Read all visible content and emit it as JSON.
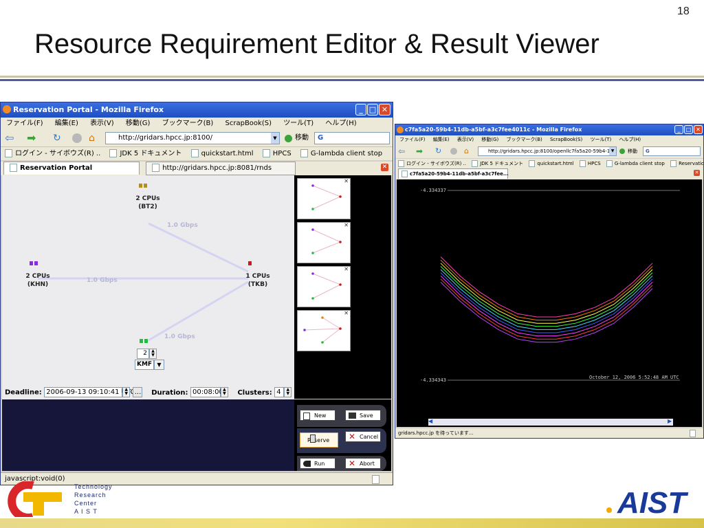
{
  "slide": {
    "number": "18",
    "title": "Resource Requirement Editor & Result Viewer",
    "logo_text": [
      "Technology",
      "Research",
      "Center",
      "A I S T"
    ],
    "aist_logo_text": "AIST"
  },
  "colors": {
    "titlebar": "#1e4fc2",
    "node_purple": "#8a2be2",
    "node_red": "#cc1a1a",
    "node_green": "#22bb44",
    "node_gold": "#b58f1a"
  },
  "left_window": {
    "title": "Reservation Portal - Mozilla Firefox",
    "menu": [
      "ファイル(F)",
      "編集(E)",
      "表示(V)",
      "移動(G)",
      "ブックマーク(B)",
      "ScrapBook(S)",
      "ツール(T)",
      "ヘルプ(H)"
    ],
    "url": "http://gridars.hpcc.jp:8100/",
    "go_label": "移動",
    "search_icon": "G",
    "bookmarks": [
      "ログイン - サイボウズ(R) ..",
      "JDK 5 ドキュメント",
      "quickstart.html",
      "HPCS",
      "G-lambda client stop"
    ],
    "tabs": [
      {
        "label": "Reservation Portal",
        "active": true
      },
      {
        "label": "http://gridars.hpcc.jp:8081/rnds",
        "active": false
      }
    ],
    "nodes": [
      {
        "cpus": "2 CPUs",
        "site": "(BT2)"
      },
      {
        "cpus": "2 CPUs",
        "site": "(KHN)"
      },
      {
        "cpus": "1 CPUs",
        "site": "(TKB)"
      }
    ],
    "links": [
      "1.0 Gbps",
      "1.0 Gbps",
      "1.0 Gbps"
    ],
    "spinner_value": "2",
    "select_value": "KMF",
    "params": {
      "deadline_label": "Deadline:",
      "deadline_value": "2006-09-13 09:10:41 UTC",
      "deadline_button": "...",
      "duration_label": "Duration:",
      "duration_value": "00:08:00",
      "clusters_label": "Clusters:",
      "clusters_value": "4"
    },
    "buttons": {
      "new": "New",
      "save": "Save",
      "reserve": "Reserve",
      "cancel": "Cancel",
      "run": "Run",
      "abort": "Abort"
    },
    "status": "javascript:void(0)"
  },
  "right_window": {
    "title": "c7fa5a20-59b4-11db-a5bf-a3c7fee4011c - Mozilla Firefox",
    "menu": [
      "ファイル(F)",
      "編集(E)",
      "表示(V)",
      "移動(G)",
      "ブックマーク(B)",
      "ScrapBook(S)",
      "ツール(T)",
      "ヘルプ(H)"
    ],
    "url": "http://gridars.hpcc.jp:8100/openllc7fa5a20-59b4-11db-a",
    "go_label": "移動",
    "search_icon": "G",
    "bookmarks": [
      "ログイン - サイボウズ(R) ..",
      "JDK 5 ドキュメント",
      "quickstart.html",
      "HPCS",
      "G-lambda client stop",
      "Reservation Portal"
    ],
    "tab": "c7fa5a20-59b4-11db-a5bf-a3c7fee...",
    "plot": {
      "top_value": "-4.334337",
      "bottom_value": "-4.334343",
      "timestamp": "October 12, 2006 5:52:48 AM UTC"
    },
    "status": "gridars.hpcc.jp を待っています..."
  },
  "chart_data": {
    "type": "line",
    "title": "",
    "xlabel": "",
    "ylabel": "",
    "ylim": [
      -4.334343,
      -4.334337
    ],
    "x": [
      0,
      1,
      2,
      3,
      4,
      5,
      6,
      7,
      8,
      9,
      10,
      11
    ],
    "grid": false,
    "series": [
      {
        "color": "#ff3fb4",
        "values": [
          -4.3343391,
          -4.3343397,
          -4.3343402,
          -4.3343406,
          -4.3343409,
          -4.334341,
          -4.334341,
          -4.3343409,
          -4.3343407,
          -4.3343404,
          -4.3343399,
          -4.3343393
        ]
      },
      {
        "color": "#ff7f00",
        "values": [
          -4.3343392,
          -4.3343398,
          -4.3343403,
          -4.3343407,
          -4.334341,
          -4.3343411,
          -4.3343411,
          -4.334341,
          -4.3343408,
          -4.3343405,
          -4.33434,
          -4.3343394
        ]
      },
      {
        "color": "#ffff40",
        "values": [
          -4.3343393,
          -4.3343399,
          -4.3343404,
          -4.3343408,
          -4.3343411,
          -4.3343412,
          -4.3343412,
          -4.3343411,
          -4.3343409,
          -4.3343406,
          -4.3343401,
          -4.3343395
        ]
      },
      {
        "color": "#40ff40",
        "values": [
          -4.3343394,
          -4.33434,
          -4.3343405,
          -4.3343409,
          -4.3343412,
          -4.3343413,
          -4.3343413,
          -4.3343412,
          -4.334341,
          -4.3343407,
          -4.3343402,
          -4.3343396
        ]
      },
      {
        "color": "#40e0ff",
        "values": [
          -4.3343395,
          -4.3343401,
          -4.3343406,
          -4.334341,
          -4.3343413,
          -4.3343414,
          -4.3343414,
          -4.3343413,
          -4.3343411,
          -4.3343408,
          -4.3343403,
          -4.3343397
        ]
      },
      {
        "color": "#4060ff",
        "values": [
          -4.3343396,
          -4.3343402,
          -4.3343407,
          -4.3343411,
          -4.3343414,
          -4.3343415,
          -4.3343415,
          -4.3343414,
          -4.3343412,
          -4.3343409,
          -4.3343404,
          -4.3343398
        ]
      },
      {
        "color": "#ff40ff",
        "values": [
          -4.3343397,
          -4.3343403,
          -4.3343408,
          -4.3343412,
          -4.3343415,
          -4.3343416,
          -4.3343416,
          -4.3343415,
          -4.3343413,
          -4.334341,
          -4.3343405,
          -4.3343399
        ]
      },
      {
        "color": "#ff4040",
        "values": [
          -4.3343398,
          -4.3343404,
          -4.3343409,
          -4.3343413,
          -4.3343416,
          -4.3343417,
          -4.3343417,
          -4.3343416,
          -4.3343414,
          -4.3343411,
          -4.3343406,
          -4.33434
        ]
      },
      {
        "color": "#c040ff",
        "values": [
          -4.3343399,
          -4.3343405,
          -4.334341,
          -4.3343414,
          -4.3343417,
          -4.3343418,
          -4.3343418,
          -4.3343417,
          -4.3343415,
          -4.3343412,
          -4.3343407,
          -4.3343401
        ]
      }
    ]
  }
}
